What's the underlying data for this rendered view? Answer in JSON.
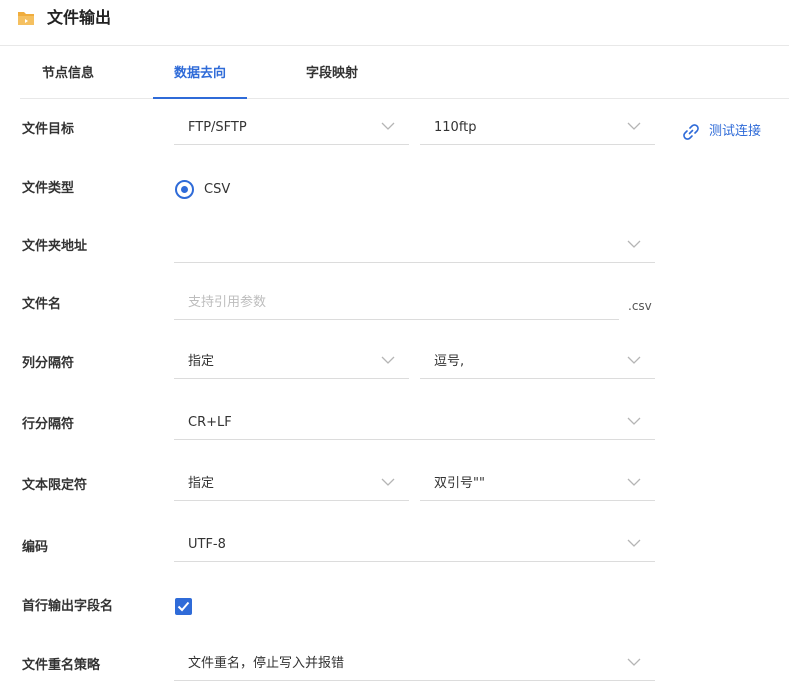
{
  "header": {
    "title": "文件输出",
    "icon": "folder-icon",
    "icon_color": "#f0ad3d"
  },
  "tabs": [
    {
      "label": "节点信息",
      "active": false
    },
    {
      "label": "数据去向",
      "active": true
    },
    {
      "label": "字段映射",
      "active": false
    }
  ],
  "accent_color": "#2f6bd8",
  "form": {
    "file_target": {
      "label": "文件目标",
      "type_value": "FTP/SFTP",
      "connection_value": "110ftp",
      "test_link": "测试连接"
    },
    "file_type": {
      "label": "文件类型",
      "option": "CSV",
      "selected": true
    },
    "folder_path": {
      "label": "文件夹地址",
      "value": ""
    },
    "file_name": {
      "label": "文件名",
      "placeholder": "支持引用参数",
      "suffix": ".csv"
    },
    "column_separator": {
      "label": "列分隔符",
      "mode_value": "指定",
      "value": "逗号,"
    },
    "row_separator": {
      "label": "行分隔符",
      "value": "CR+LF"
    },
    "text_qualifier": {
      "label": "文本限定符",
      "mode_value": "指定",
      "value": "双引号\"\""
    },
    "encoding": {
      "label": "编码",
      "value": "UTF-8"
    },
    "header_row": {
      "label": "首行输出字段名",
      "checked": true
    },
    "rename_strategy": {
      "label": "文件重名策略",
      "value": "文件重名，停止写入并报错"
    }
  }
}
